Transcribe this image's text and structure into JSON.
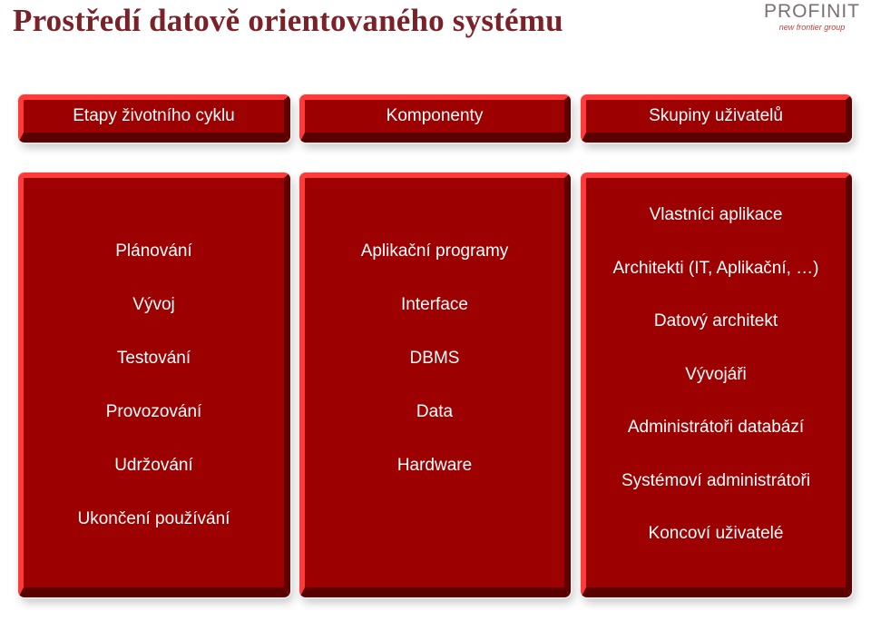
{
  "slide": {
    "title": "Prostředí datově orientovaného systému",
    "logo": {
      "name": "PROFINIT",
      "tagline": "new frontier group"
    }
  },
  "colors": {
    "title": "#7b2128",
    "box_fill": "#9d0000",
    "box_highlight": "#ff3a3a",
    "box_shadow": "#5a0000",
    "text": "#ffffff"
  },
  "columns": [
    {
      "header": "Etapy životního cyklu",
      "items": [
        "Plánování",
        "Vývoj",
        "Testování",
        "Provozování",
        "Udržování",
        "Ukončení používání"
      ]
    },
    {
      "header": "Komponenty",
      "items": [
        "Aplikační programy",
        "Interface",
        "DBMS",
        "Data",
        "Hardware"
      ]
    },
    {
      "header": "Skupiny uživatelů",
      "items": [
        "Vlastníci aplikace",
        "Architekti (IT, Aplikační, …)",
        "Datový architekt",
        "Vývojáři",
        "Administrátoři databází",
        "Systémoví administrátoři",
        "Koncoví uživatelé"
      ]
    }
  ]
}
